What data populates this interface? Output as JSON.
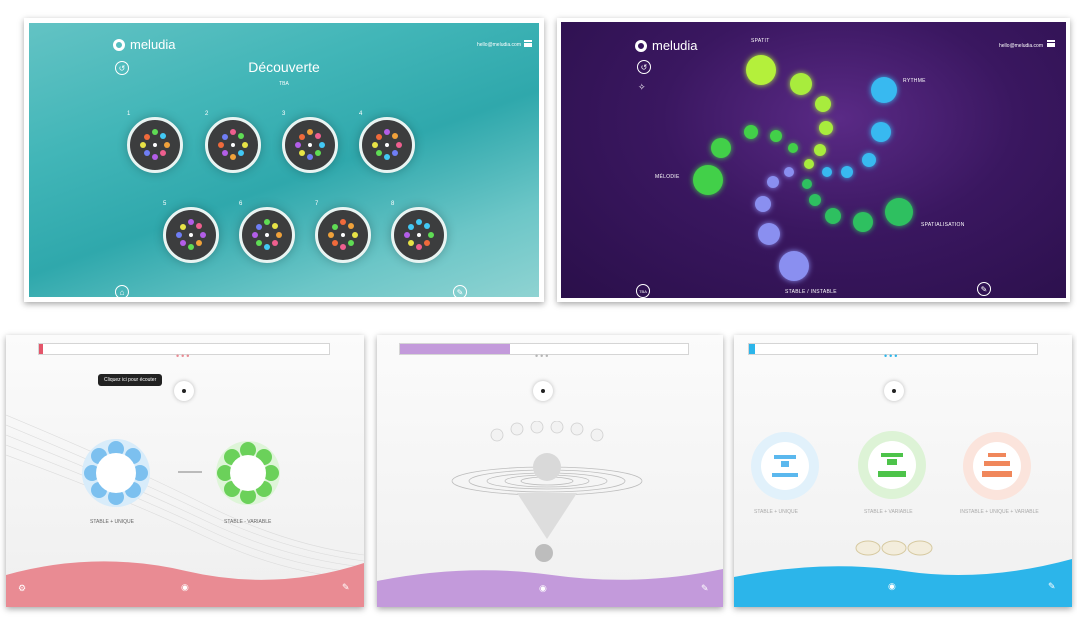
{
  "panels": {
    "discovery": {
      "logo": "meludia",
      "email": "hello@meludia.com",
      "title": "Découverte",
      "subtitle": "TBA",
      "exercise_numbers": [
        "1",
        "2",
        "3",
        "4",
        "5",
        "6",
        "7",
        "8"
      ],
      "bg_color": "#3fb4b6"
    },
    "map": {
      "logo": "meludia",
      "email": "hello@meludia.com",
      "labels": {
        "top": "SPATIT",
        "right": "RYTHME",
        "left": "MÉLODIE",
        "bottom_right": "SPATIALISATION",
        "bottom": "STABLE / INSTABLE"
      },
      "corner_button": "TBA",
      "bg_color": "#3a1760"
    },
    "stable": {
      "tooltip": "Cliquez ici pour écouter",
      "caption_left": "STABLE + UNIQUE",
      "caption_right": "STABLE - VARIABLE",
      "accent": "#e98b93",
      "progress": 0.0
    },
    "funnel": {
      "accent": "#c39adb",
      "progress": 0.3
    },
    "colors": {
      "caption_left": "STABLE + UNIQUE",
      "caption_mid": "STABLE + VARIABLE",
      "caption_right": "INSTABLE + UNIQUE + VARIABLE",
      "accent": "#2cb5ea",
      "progress": 0.02
    }
  }
}
